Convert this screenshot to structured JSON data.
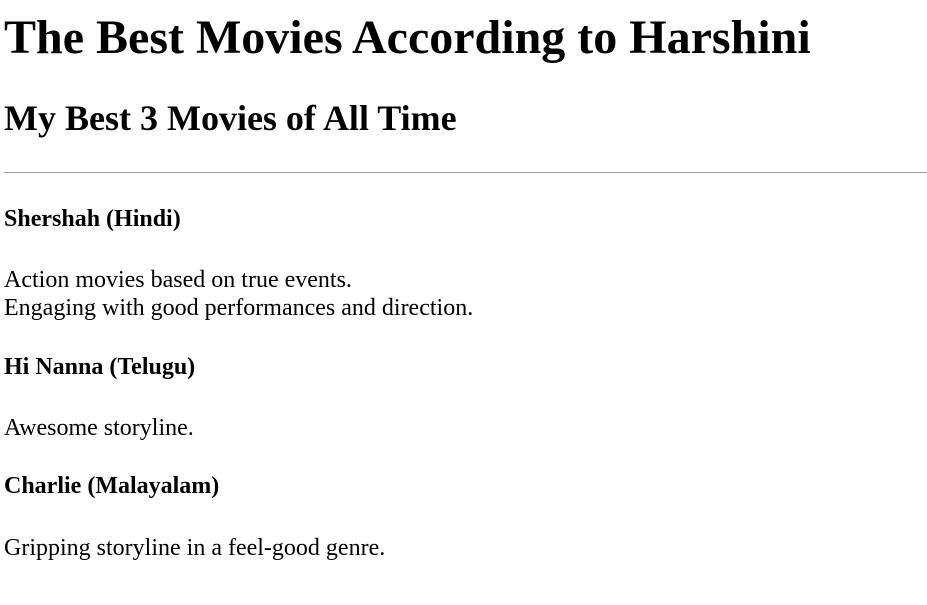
{
  "page": {
    "title": "The Best Movies According to Harshini",
    "subtitle": "My Best 3 Movies of All Time"
  },
  "movies": [
    {
      "title": "Shershah (Hindi)",
      "lines": [
        "Action movies based on true events.",
        "Engaging with good performances and direction."
      ]
    },
    {
      "title": "Hi Nanna (Telugu)",
      "lines": [
        "Awesome storyline."
      ]
    },
    {
      "title": "Charlie (Malayalam)",
      "lines": [
        "Gripping storyline in a feel-good genre."
      ]
    }
  ]
}
